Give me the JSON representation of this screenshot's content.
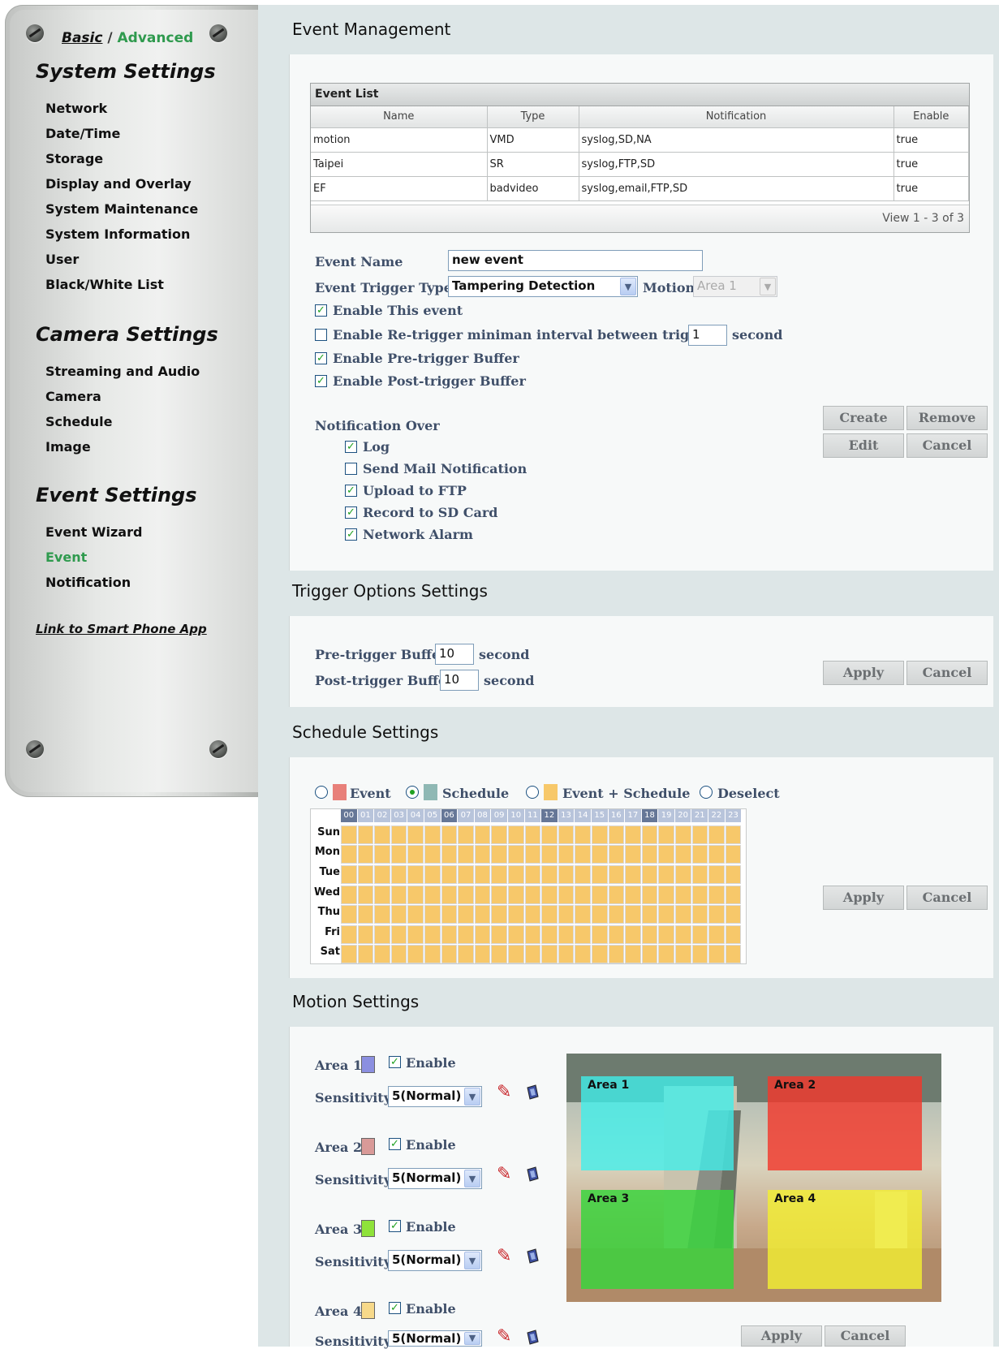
{
  "mode": {
    "basic": "Basic",
    "separator": "/",
    "advanced": "Advanced"
  },
  "sidebar": {
    "system_title": "System Settings",
    "system_items": [
      "Network",
      "Date/Time",
      "Storage",
      "Display and Overlay",
      "System Maintenance",
      "System Information",
      "User",
      "Black/White List"
    ],
    "camera_title": "Camera Settings",
    "camera_items": [
      "Streaming and Audio",
      "Camera",
      "Schedule",
      "Image"
    ],
    "event_title": "Event Settings",
    "event_items": [
      "Event Wizard",
      "Event",
      "Notification"
    ],
    "active_item": "Event",
    "smart_link": "Link to Smart Phone App"
  },
  "event_mgmt": {
    "heading": "Event Management",
    "table": {
      "caption": "Event List",
      "headers": [
        "Name",
        "Type",
        "Notification",
        "Enable"
      ],
      "rows": [
        [
          "motion",
          "VMD",
          "syslog,SD,NA",
          "true"
        ],
        [
          "Taipei",
          "SR",
          "syslog,FTP,SD",
          "true"
        ],
        [
          "EF",
          "badvideo",
          "syslog,email,FTP,SD",
          "true"
        ]
      ],
      "footer": "View 1 - 3 of 3"
    },
    "event_name_label": "Event Name",
    "event_name_value": "new event",
    "trigger_type_label": "Event Trigger Type",
    "trigger_type_value": "Tampering Detection",
    "motion_label": "Motion",
    "motion_value": "Area 1",
    "enable_event": "Enable This event",
    "retrigger": "Enable Re-trigger miniman interval between triggers",
    "retrigger_value": "1",
    "retrigger_unit": "second",
    "pre_buffer": "Enable Pre-trigger Buffer",
    "post_buffer": "Enable Post-trigger Buffer",
    "notification_over": "Notification Over",
    "notify": [
      "Log",
      "Send Mail Notification",
      "Upload to FTP",
      "Record to SD Card",
      "Network Alarm"
    ],
    "notify_checked": [
      true,
      false,
      true,
      true,
      true
    ],
    "buttons": {
      "create": "Create",
      "remove": "Remove",
      "edit": "Edit",
      "cancel": "Cancel"
    }
  },
  "trigger_opts": {
    "heading": "Trigger Options Settings",
    "pre_label": "Pre-trigger Buffer",
    "pre_value": "10",
    "post_label": "Post-trigger Buffer",
    "post_value": "10",
    "unit": "second",
    "apply": "Apply",
    "cancel": "Cancel"
  },
  "schedule": {
    "heading": "Schedule Settings",
    "legend": [
      "Event",
      "Schedule",
      "Event + Schedule",
      "Deselect"
    ],
    "legend_colors": [
      "#e8807a",
      "#8fb8b4",
      "#f7c86a",
      ""
    ],
    "selected": "Schedule",
    "hours": [
      "00",
      "01",
      "02",
      "03",
      "04",
      "05",
      "06",
      "07",
      "08",
      "09",
      "10",
      "11",
      "12",
      "13",
      "14",
      "15",
      "16",
      "17",
      "18",
      "19",
      "20",
      "21",
      "22",
      "23"
    ],
    "days": [
      "Sun",
      "Mon",
      "Tue",
      "Wed",
      "Thu",
      "Fri",
      "Sat"
    ],
    "cell_color": "#f7c86a",
    "apply": "Apply",
    "cancel": "Cancel"
  },
  "motion": {
    "heading": "Motion Settings",
    "areas": [
      {
        "label": "Area 1",
        "color": "#8b8fe0",
        "enable": "Enable",
        "sensitivity_label": "Sensitivity",
        "sensitivity": "5(Normal)",
        "overlay": "#3ff0ec"
      },
      {
        "label": "Area 2",
        "color": "#d99a98",
        "enable": "Enable",
        "sensitivity_label": "Sensitivity",
        "sensitivity": "5(Normal)",
        "overlay": "#f2382c"
      },
      {
        "label": "Area 3",
        "color": "#8fe23a",
        "enable": "Enable",
        "sensitivity_label": "Sensitivity",
        "sensitivity": "5(Normal)",
        "overlay": "#36d63a"
      },
      {
        "label": "Area 4",
        "color": "#f7d98a",
        "enable": "Enable",
        "sensitivity_label": "Sensitivity",
        "sensitivity": "5(Normal)",
        "overlay": "#f4f030"
      }
    ],
    "apply": "Apply",
    "cancel": "Cancel"
  }
}
